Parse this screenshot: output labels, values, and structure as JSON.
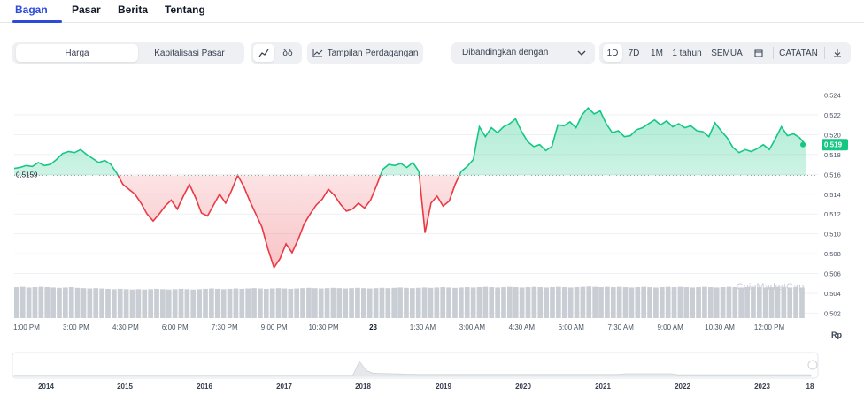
{
  "tabs": [
    {
      "label": "Bagan",
      "active": true
    },
    {
      "label": "Pasar",
      "active": false
    },
    {
      "label": "Berita",
      "active": false
    },
    {
      "label": "Tentang",
      "active": false
    }
  ],
  "toolbar": {
    "price_label": "Harga",
    "market_cap_label": "Kapitalisasi Pasar",
    "line_icon": "line-chart-icon",
    "candle_label": "δδ",
    "trading_view_label": "Tampilan Perdagangan",
    "compare_label": "Dibandingkan dengan",
    "ranges": [
      "1D",
      "7D",
      "1M",
      "1 tahun",
      "SEMUA"
    ],
    "active_range": "1D",
    "notes_label": "CATATAN"
  },
  "colors": {
    "up": "#16c784",
    "down": "#ea3943",
    "accent": "#2b4bd8",
    "volume": "#c9cdd4"
  },
  "chart_data": {
    "type": "line",
    "reference_label": "0,5159",
    "reference_value": 0.5159,
    "current_label": "0.519",
    "current_value": 0.519,
    "y_ticks": [
      "0.524",
      "0.522",
      "0.520",
      "0.518",
      "0.516",
      "0.514",
      "0.512",
      "0.510",
      "0.508",
      "0.506",
      "0.504",
      "0.502"
    ],
    "ylim": [
      0.5015,
      0.5245
    ],
    "x_ticks": [
      "1:00 PM",
      "3:00 PM",
      "4:30 PM",
      "6:00 PM",
      "7:30 PM",
      "9:00 PM",
      "10:30 PM",
      "23",
      "1:30 AM",
      "3:00 AM",
      "4:30 AM",
      "6:00 AM",
      "7:30 AM",
      "9:00 AM",
      "10:30 AM",
      "12:00 PM"
    ],
    "y_unit": "Rp",
    "watermark": "CoinMarketCap",
    "series": [
      {
        "values": [
          0.5166,
          0.5167,
          0.5169,
          0.5168,
          0.5172,
          0.5169,
          0.517,
          0.5175,
          0.5181,
          0.5183,
          0.5182,
          0.5185,
          0.518,
          0.5176,
          0.5172,
          0.5174,
          0.517,
          0.5161,
          0.515,
          0.5145,
          0.514,
          0.5131,
          0.512,
          0.5113,
          0.512,
          0.5128,
          0.5134,
          0.5125,
          0.5138,
          0.515,
          0.5137,
          0.5121,
          0.5118,
          0.5129,
          0.514,
          0.5131,
          0.5144,
          0.5159,
          0.5148,
          0.5133,
          0.512,
          0.5107,
          0.5085,
          0.5066,
          0.5075,
          0.509,
          0.5081,
          0.5094,
          0.511,
          0.512,
          0.5129,
          0.5135,
          0.5145,
          0.5139,
          0.513,
          0.5123,
          0.5125,
          0.5131,
          0.5126,
          0.5134,
          0.5149,
          0.5165,
          0.517,
          0.5169,
          0.5171,
          0.5167,
          0.5172,
          0.5163,
          0.5101,
          0.5131,
          0.5138,
          0.5128,
          0.5133,
          0.515,
          0.5163,
          0.5168,
          0.5175,
          0.5208,
          0.5198,
          0.5207,
          0.5202,
          0.5208,
          0.5211,
          0.5216,
          0.5203,
          0.5193,
          0.5188,
          0.519,
          0.5184,
          0.5188,
          0.521,
          0.5209,
          0.5213,
          0.5207,
          0.522,
          0.5227,
          0.5221,
          0.5224,
          0.5211,
          0.5202,
          0.5204,
          0.5198,
          0.5199,
          0.5205,
          0.5207,
          0.5211,
          0.5215,
          0.521,
          0.5214,
          0.5208,
          0.5211,
          0.5207,
          0.5209,
          0.5204,
          0.5203,
          0.5198,
          0.5212,
          0.5204,
          0.5197,
          0.5187,
          0.5182,
          0.5185,
          0.5183,
          0.5186,
          0.519,
          0.5185,
          0.5196,
          0.5208,
          0.5199,
          0.5201,
          0.5197,
          0.519
        ]
      }
    ],
    "volumes": [
      0.92,
      0.93,
      0.91,
      0.92,
      0.93,
      0.92,
      0.91,
      0.9,
      0.91,
      0.92,
      0.9,
      0.89,
      0.88,
      0.89,
      0.88,
      0.87,
      0.86,
      0.87,
      0.86,
      0.85,
      0.86,
      0.85,
      0.86,
      0.87,
      0.86,
      0.85,
      0.86,
      0.87,
      0.86,
      0.85,
      0.86,
      0.87,
      0.88,
      0.87,
      0.86,
      0.87,
      0.88,
      0.87,
      0.88,
      0.89,
      0.88,
      0.87,
      0.88,
      0.89,
      0.88,
      0.87,
      0.88,
      0.89,
      0.9,
      0.89,
      0.88,
      0.89,
      0.9,
      0.89,
      0.88,
      0.89,
      0.9,
      0.89,
      0.88,
      0.89,
      0.9,
      0.89,
      0.9,
      0.91,
      0.9,
      0.89,
      0.9,
      0.91,
      0.9,
      0.91,
      0.92,
      0.91,
      0.9,
      0.91,
      0.92,
      0.91,
      0.92,
      0.93,
      0.92,
      0.91,
      0.92,
      0.93,
      0.92,
      0.91,
      0.92,
      0.93,
      0.92,
      0.91,
      0.92,
      0.93,
      0.92,
      0.91,
      0.92,
      0.93,
      0.94,
      0.93,
      0.92,
      0.93,
      0.92,
      0.93,
      0.92,
      0.91,
      0.92,
      0.93,
      0.92,
      0.91,
      0.92,
      0.93,
      0.92,
      0.93,
      0.92,
      0.91,
      0.92,
      0.93,
      0.92,
      0.91,
      0.92,
      0.93,
      0.92,
      0.91,
      0.92,
      0.93,
      0.92,
      0.91,
      0.92,
      0.93,
      0.92,
      0.91,
      0.92,
      0.91
    ]
  },
  "navigator": {
    "years": [
      "2014",
      "2015",
      "2016",
      "2017",
      "2018",
      "2019",
      "2020",
      "2021",
      "2022",
      "2023",
      "18"
    ]
  }
}
